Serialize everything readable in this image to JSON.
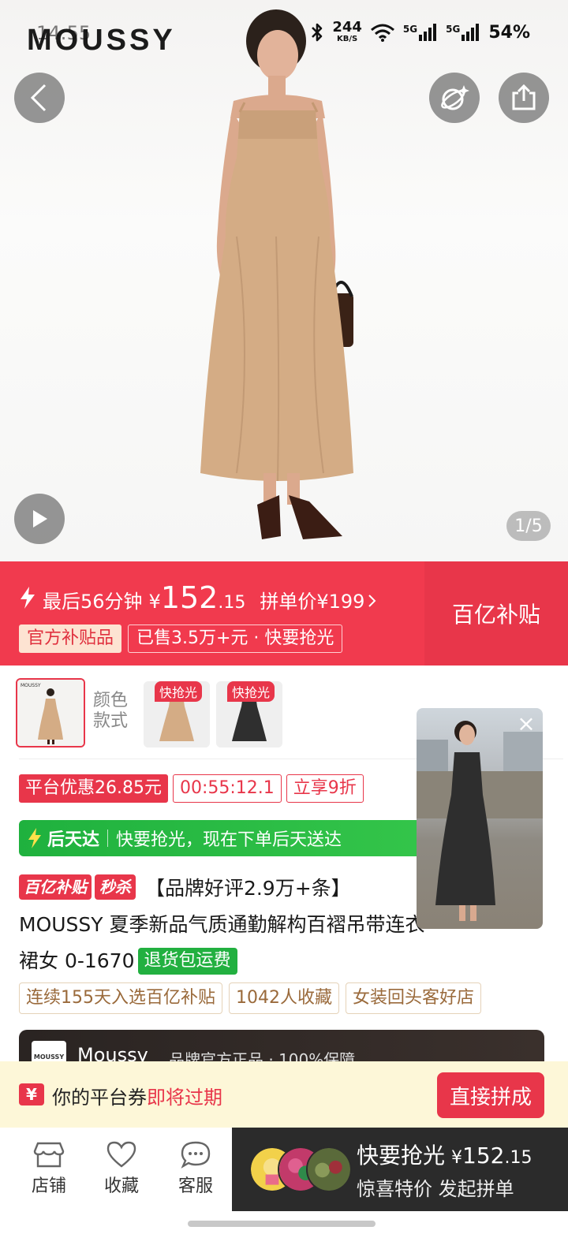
{
  "status_bar": {
    "time": "14:55",
    "net_speed_value": "244",
    "net_speed_unit": "KB/S",
    "sig1": "5G",
    "sig2": "5G",
    "battery": "54%"
  },
  "brand": {
    "logo": "MOUSSY"
  },
  "hero": {
    "page_indicator": "1/5"
  },
  "price_banner": {
    "flash_text": "最后56分钟",
    "currency": "¥",
    "price_int": "152",
    "price_dec": ".15",
    "group_label": "拼单价¥199",
    "tag_official": "官方补贴品",
    "tag_sold": "已售3.5万+元 · 快要抢光",
    "right_label": "百亿补贴"
  },
  "color_options": {
    "label_line1": "颜色",
    "label_line2": "款式",
    "items": [
      {
        "tag": ""
      },
      {
        "tag": "快抢光"
      },
      {
        "tag": "快抢光"
      }
    ]
  },
  "promo": {
    "platform_discount": "平台优惠26.85元",
    "countdown": "00:55:12.1",
    "instant": "立享9折"
  },
  "delivery": {
    "label": "后天达",
    "text": "快要抢光，现在下单后天送达"
  },
  "title": {
    "badge1": "百亿补贴",
    "badge2": "秒杀",
    "text": "【品牌好评2.9万+条】MOUSSY 夏季新品气质通勤解构百褶吊带连衣裙女 0-1670",
    "return_badge": "退货包运费"
  },
  "chips": [
    "连续155天入选百亿补贴",
    "1042人收藏",
    "女装回头客好店"
  ],
  "brand_bar": {
    "logo_small": "MOUSSY",
    "name": "Moussy",
    "desc": "品牌官方正品 · 100%保障"
  },
  "coupon": {
    "icon": "¥",
    "text_prefix": "你的平台券",
    "text_highlight": "即将过期",
    "button": "直接拼成"
  },
  "bottom_nav": {
    "shop": "店铺",
    "fav": "收藏",
    "service": "客服"
  },
  "buy": {
    "line1": "快要抢光",
    "currency": "¥",
    "price_int": "152",
    "price_dec": ".15",
    "line2": "惊喜特价 发起拼单"
  }
}
